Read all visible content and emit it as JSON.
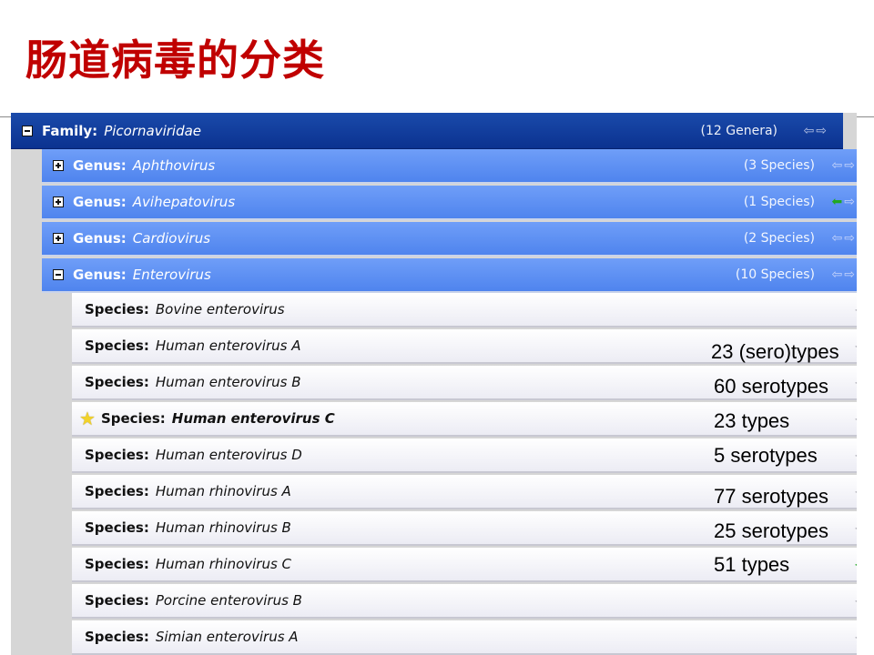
{
  "slide": {
    "title": "肠道病毒的分类"
  },
  "family": {
    "rank": "Family:",
    "name": "Picornaviridae",
    "count": "(12 Genera)"
  },
  "genera": [
    {
      "rank": "Genus:",
      "name": "Aphthovirus",
      "count": "(3 Species)",
      "expanded": false
    },
    {
      "rank": "Genus:",
      "name": "Avihepatovirus",
      "count": "(1 Species)",
      "expanded": false
    },
    {
      "rank": "Genus:",
      "name": "Cardiovirus",
      "count": "(2 Species)",
      "expanded": false
    },
    {
      "rank": "Genus:",
      "name": "Enterovirus",
      "count": "(10 Species)",
      "expanded": true
    }
  ],
  "species": [
    {
      "rank": "Species:",
      "name": "Bovine enterovirus"
    },
    {
      "rank": "Species:",
      "name": "Human enterovirus A",
      "note": "23 (sero)types"
    },
    {
      "rank": "Species:",
      "name": "Human enterovirus B",
      "note": "60 serotypes"
    },
    {
      "rank": "Species:",
      "name": "Human enterovirus C",
      "note": "23 types",
      "starred": true
    },
    {
      "rank": "Species:",
      "name": "Human enterovirus D",
      "note": "5 serotypes"
    },
    {
      "rank": "Species:",
      "name": "Human rhinovirus A",
      "note": "77 serotypes"
    },
    {
      "rank": "Species:",
      "name": "Human rhinovirus B",
      "note": "25 serotypes"
    },
    {
      "rank": "Species:",
      "name": "Human rhinovirus C",
      "note": "51 types"
    },
    {
      "rank": "Species:",
      "name": "Porcine enterovirus B"
    },
    {
      "rank": "Species:",
      "name": "Simian enterovirus A"
    }
  ],
  "colors": {
    "title": "#c00000",
    "family_bar": "#0b3290",
    "genus_bar": "#4f84ee",
    "nav_active": "#22a822",
    "star": "#f2d22a"
  },
  "icons": {
    "collapse": "minus-box-icon",
    "expand": "plus-box-icon",
    "nav_back": "arrow-left-icon",
    "nav_forward": "arrow-right-icon",
    "current_species": "star-icon"
  }
}
